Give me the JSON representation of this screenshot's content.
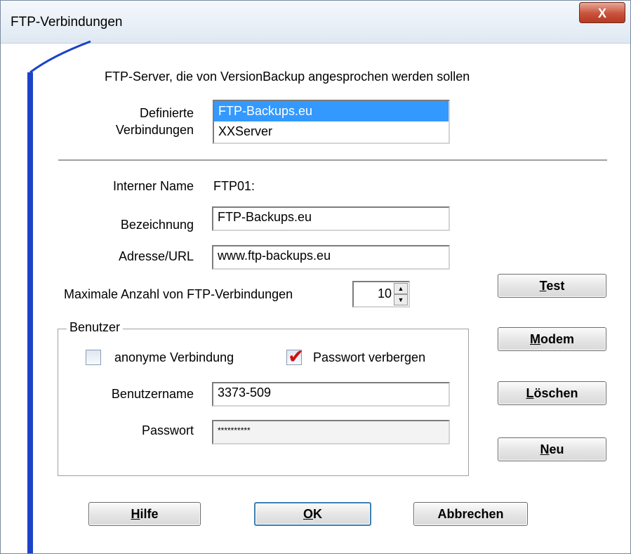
{
  "window": {
    "title": "FTP-Verbindungen",
    "close_glyph": "X"
  },
  "header_text": "FTP-Server, die von VersionBackup angesprochen werden sollen",
  "connections": {
    "label_line1": "Definierte",
    "label_line2": "Verbindungen",
    "items": [
      {
        "label": "FTP-Backups.eu",
        "selected": true
      },
      {
        "label": "XXServer",
        "selected": false
      }
    ]
  },
  "internal_name": {
    "label": "Interner Name",
    "value": "FTP01:"
  },
  "bezeichnung": {
    "label": "Bezeichnung",
    "value": "FTP-Backups.eu"
  },
  "adresse": {
    "label": "Adresse/URL",
    "value": "www.ftp-backups.eu"
  },
  "max_connections": {
    "label": "Maximale Anzahl von FTP-Verbindungen",
    "value": "10"
  },
  "benutzer": {
    "group_label": "Benutzer",
    "anonymous": {
      "label": "anonyme Verbindung",
      "checked": false
    },
    "hide_password": {
      "label": "Passwort verbergen",
      "checked": true,
      "check_glyph": "✔"
    },
    "username": {
      "label": "Benutzername",
      "value": "3373-509"
    },
    "password": {
      "label": "Passwort",
      "value": "**********"
    }
  },
  "side_buttons": {
    "test": {
      "mnemonic": "T",
      "rest": "est"
    },
    "modem": {
      "mnemonic": "M",
      "rest": "odem"
    },
    "loeschen": {
      "mnemonic": "L",
      "rest": "öschen"
    },
    "neu": {
      "mnemonic": "N",
      "rest": "eu"
    }
  },
  "bottom_buttons": {
    "hilfe": {
      "mnemonic": "H",
      "rest": "ilfe"
    },
    "ok": {
      "mnemonic": "O",
      "rest": "K"
    },
    "abbrechen": {
      "label": "Abbrechen"
    }
  },
  "colors": {
    "selection": "#3399ff",
    "accent": "#1a43c8",
    "check": "#cc1111"
  }
}
